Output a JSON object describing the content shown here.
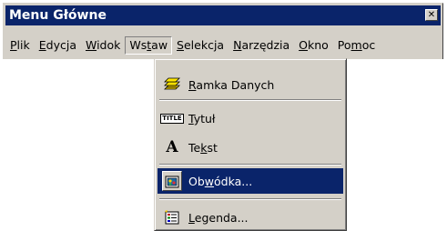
{
  "window": {
    "title": "Menu Główne",
    "close_glyph": "✕"
  },
  "menubar": {
    "items": [
      {
        "pre": "",
        "acc": "P",
        "post": "lik"
      },
      {
        "pre": "",
        "acc": "E",
        "post": "dycja"
      },
      {
        "pre": "",
        "acc": "W",
        "post": "idok"
      },
      {
        "pre": "Ws",
        "acc": "t",
        "post": "aw"
      },
      {
        "pre": "",
        "acc": "S",
        "post": "elekcja"
      },
      {
        "pre": "",
        "acc": "N",
        "post": "arzędzia"
      },
      {
        "pre": "",
        "acc": "O",
        "post": "kno"
      },
      {
        "pre": "Po",
        "acc": "m",
        "post": "oc"
      }
    ],
    "open_item": "Wstaw"
  },
  "dropdown": {
    "items": [
      {
        "icon": "data-frame-icon",
        "pre": "",
        "acc": "R",
        "post": "amka Danych"
      },
      {
        "icon": "title-icon",
        "pre": "",
        "acc": "T",
        "post": "ytuł",
        "icon_text": "TITLE"
      },
      {
        "icon": "text-icon",
        "pre": "Te",
        "acc": "k",
        "post": "st",
        "icon_text": "A"
      },
      {
        "icon": "border-icon",
        "pre": "Ob",
        "acc": "w",
        "post": "ódka...",
        "selected": true
      },
      {
        "icon": "legend-icon",
        "pre": "",
        "acc": "L",
        "post": "egenda..."
      }
    ]
  },
  "colors": {
    "face": "#d4d0c8",
    "highlight": "#0a246a",
    "highlight_text": "#ffffff"
  }
}
